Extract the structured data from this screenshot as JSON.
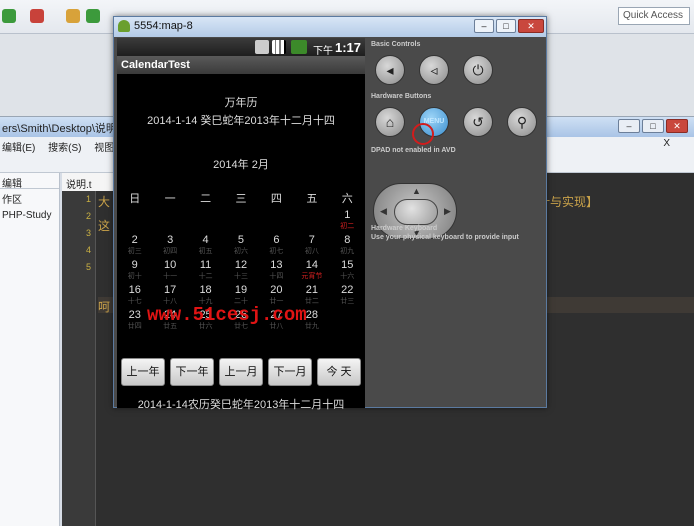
{
  "ide": {
    "quick_access": "Quick Access",
    "path_fragment": "ers\\Smith\\Desktop\\说明.t",
    "menu": [
      "编辑(E)",
      "搜索(S)",
      "视图(V)"
    ],
    "close_x": "X",
    "left_panel": {
      "header": "编辑",
      "item1": "作区",
      "item2": "PHP-Study"
    },
    "editor_tab": "说明.t",
    "line_numbers": [
      "1",
      "2",
      "3",
      "4",
      "5"
    ],
    "line1": "大",
    "line2": "这",
    "line5": "呵",
    "right_text": "计与实现】"
  },
  "emulator": {
    "title": "5554:map-8",
    "status_ampm": "下午",
    "status_time": "1:17",
    "app_title": "CalendarTest",
    "calendar_title": "万年历",
    "calendar_date_line": "2014-1-14  癸巳蛇年2013年十二月十四",
    "month_title": "2014年 2月",
    "weekdays": [
      "日",
      "一",
      "二",
      "三",
      "四",
      "五",
      "六"
    ],
    "weeks": [
      [
        {
          "d": "",
          "l": ""
        },
        {
          "d": "",
          "l": ""
        },
        {
          "d": "",
          "l": ""
        },
        {
          "d": "",
          "l": ""
        },
        {
          "d": "",
          "l": ""
        },
        {
          "d": "",
          "l": ""
        },
        {
          "d": "1",
          "l": "初二",
          "red": true
        }
      ],
      [
        {
          "d": "2",
          "l": "初三"
        },
        {
          "d": "3",
          "l": "初四"
        },
        {
          "d": "4",
          "l": "初五"
        },
        {
          "d": "5",
          "l": "初六"
        },
        {
          "d": "6",
          "l": "初七"
        },
        {
          "d": "7",
          "l": "初八"
        },
        {
          "d": "8",
          "l": "初九"
        }
      ],
      [
        {
          "d": "9",
          "l": "初十"
        },
        {
          "d": "10",
          "l": "十一"
        },
        {
          "d": "11",
          "l": "十二"
        },
        {
          "d": "12",
          "l": "十三"
        },
        {
          "d": "13",
          "l": "十四"
        },
        {
          "d": "14",
          "l": "元宵节",
          "red": true
        },
        {
          "d": "15",
          "l": "十六"
        }
      ],
      [
        {
          "d": "16",
          "l": "十七"
        },
        {
          "d": "17",
          "l": "十八"
        },
        {
          "d": "18",
          "l": "十九"
        },
        {
          "d": "19",
          "l": "二十"
        },
        {
          "d": "20",
          "l": "廿一"
        },
        {
          "d": "21",
          "l": "廿二"
        },
        {
          "d": "22",
          "l": "廿三"
        }
      ],
      [
        {
          "d": "23",
          "l": "廿四"
        },
        {
          "d": "24",
          "l": "廿五"
        },
        {
          "d": "25",
          "l": "廿六"
        },
        {
          "d": "26",
          "l": "廿七"
        },
        {
          "d": "27",
          "l": "廿八"
        },
        {
          "d": "28",
          "l": "廿九"
        },
        {
          "d": "",
          "l": ""
        }
      ]
    ],
    "watermark": "www.51cesj.com",
    "buttons": [
      "上一年",
      "下一年",
      "上一月",
      "下一月",
      "今 天"
    ],
    "footer": "2014-1-14农历癸巳蛇年2013年十二月十四",
    "controls": {
      "basic_label": "Basic Controls",
      "hardware_label": "Hardware Buttons",
      "menu_label": "MENU",
      "dpad_label": "DPAD not enabled in AVD",
      "keyboard_label": "Hardware Keyboard",
      "keyboard_hint": "Use your physical keyboard to provide input"
    }
  }
}
